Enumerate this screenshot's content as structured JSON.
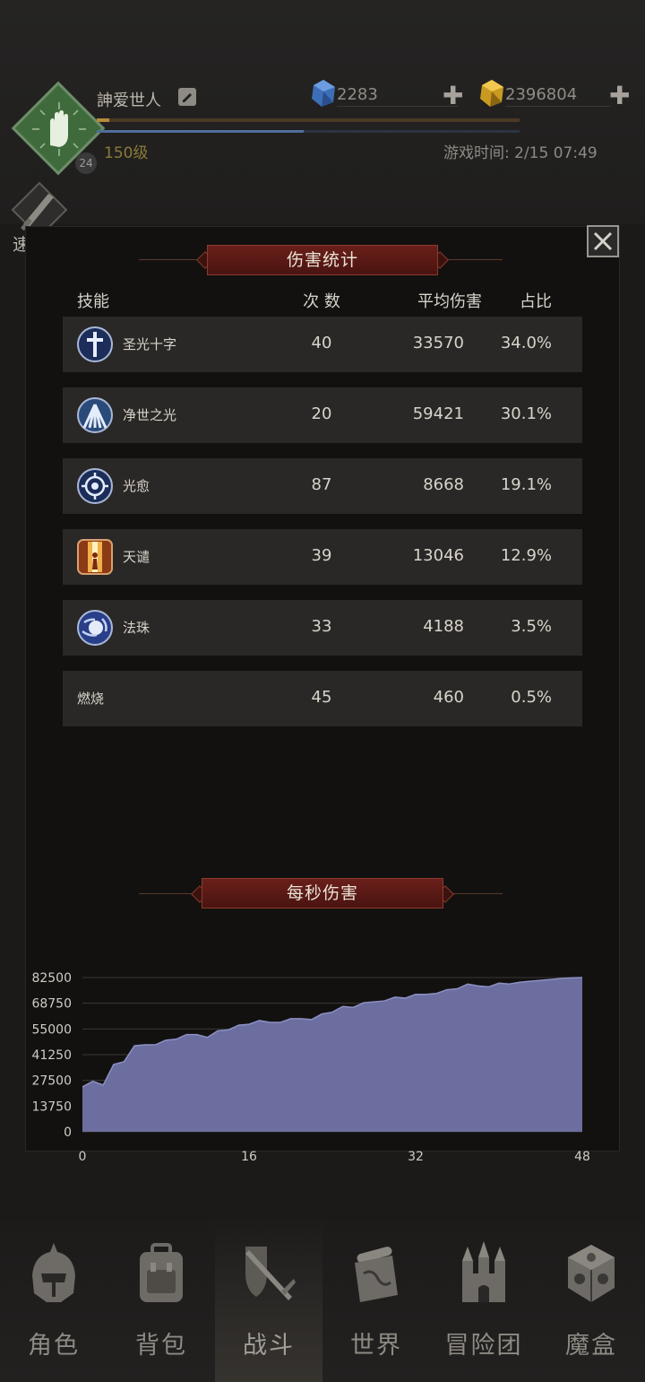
{
  "player": {
    "name": "訷爱世人",
    "badge_level": "24",
    "level_text": "150级",
    "game_time": "游戏时间: 2/15 07:49"
  },
  "resources": {
    "gems": "2283",
    "gold": "2396804",
    "add_symbol": "✚"
  },
  "quick_battle": {
    "label": "速战"
  },
  "damage_stats": {
    "title": "伤害统计",
    "headers": {
      "skill": "技能",
      "count": "次 数",
      "avg": "平均伤害",
      "share": "占比"
    },
    "rows": [
      {
        "name": "圣光十字",
        "count": "40",
        "avg": "33570",
        "share": "34.0%",
        "icon": "holy-cross-icon"
      },
      {
        "name": "净世之光",
        "count": "20",
        "avg": "59421",
        "share": "30.1%",
        "icon": "purifying-light-icon"
      },
      {
        "name": "光愈",
        "count": "87",
        "avg": "8668",
        "share": "19.1%",
        "icon": "light-heal-icon"
      },
      {
        "name": "天谴",
        "count": "39",
        "avg": "13046",
        "share": "12.9%",
        "icon": "divine-wrath-icon"
      },
      {
        "name": "法珠",
        "count": "33",
        "avg": "4188",
        "share": "3.5%",
        "icon": "magic-orb-icon"
      },
      {
        "name": "燃烧",
        "count": "45",
        "avg": "460",
        "share": "0.5%",
        "icon": ""
      }
    ]
  },
  "dps": {
    "title": "每秒伤害"
  },
  "chart_data": {
    "type": "area",
    "title": "每秒伤害",
    "xlabel": "",
    "ylabel": "",
    "xlim": [
      0,
      48
    ],
    "ylim": [
      0,
      82500
    ],
    "x_ticks": [
      "0",
      "16",
      "32",
      "48"
    ],
    "y_ticks": [
      "0",
      "13750",
      "27500",
      "41250",
      "55000",
      "68750",
      "82500"
    ],
    "grid": "horizontal",
    "fill_color": "#6b6e9e",
    "line_color": "#8c90c4",
    "x": [
      0,
      1,
      2,
      3,
      4,
      5,
      6,
      7,
      8,
      9,
      10,
      11,
      12,
      13,
      14,
      15,
      16,
      17,
      18,
      19,
      20,
      21,
      22,
      23,
      24,
      25,
      26,
      27,
      28,
      29,
      30,
      31,
      32,
      33,
      34,
      35,
      36,
      37,
      38,
      39,
      40,
      41,
      42,
      43,
      44,
      45,
      46,
      47,
      48
    ],
    "values": [
      24000,
      27000,
      25000,
      36000,
      37500,
      46000,
      46500,
      46500,
      49000,
      49500,
      52000,
      52000,
      50500,
      54000,
      54500,
      57000,
      57500,
      59500,
      58500,
      58500,
      60500,
      60500,
      60000,
      63000,
      64000,
      67000,
      66500,
      69000,
      69500,
      70000,
      72000,
      71500,
      73500,
      73500,
      74000,
      76000,
      76500,
      79000,
      78000,
      77500,
      79500,
      79000,
      80000,
      80500,
      81000,
      81500,
      82000,
      82300,
      82500
    ]
  },
  "nav": {
    "items": [
      {
        "label": "角色",
        "icon": "helmet-icon"
      },
      {
        "label": "背包",
        "icon": "backpack-icon"
      },
      {
        "label": "战斗",
        "icon": "swords-icon"
      },
      {
        "label": "世界",
        "icon": "map-scroll-icon"
      },
      {
        "label": "冒险团",
        "icon": "castle-icon"
      },
      {
        "label": "魔盒",
        "icon": "magic-cube-icon"
      }
    ],
    "active": "战斗"
  }
}
